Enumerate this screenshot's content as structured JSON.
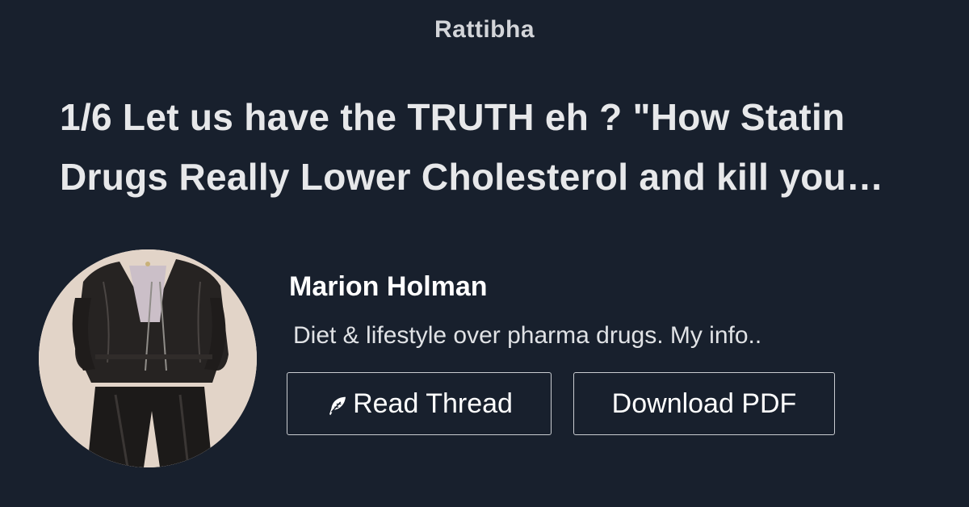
{
  "brand": "Rattibha",
  "thread": {
    "title_line1": "1/6 Let us have the TRUTH eh ? \"How Statin",
    "title_line2": "Drugs Really Lower Cholesterol and kill you…"
  },
  "author": {
    "name": "Marion Holman",
    "bio": "Diet & lifestyle over pharma drugs. My info.."
  },
  "buttons": {
    "read_label": "Read Thread",
    "read_icon": "feather-icon",
    "pdf_label": "Download PDF"
  },
  "colors": {
    "background": "#18202d",
    "text": "#e7e8ea",
    "button_border": "#c9ccd1"
  }
}
